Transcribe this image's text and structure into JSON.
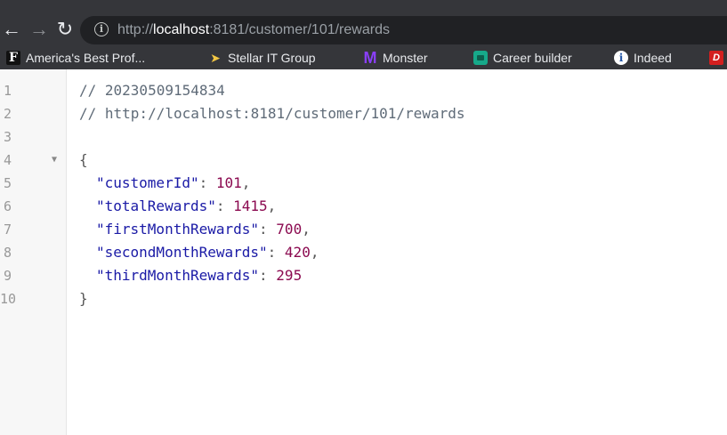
{
  "browser": {
    "url_prefix": "http://",
    "url_host": "localhost",
    "url_rest": ":8181/customer/101/rewards",
    "bookmarks": [
      {
        "label": "America's Best Prof...",
        "icon": "f-logo-icon"
      },
      {
        "label": "Stellar IT Group",
        "icon": "rocket-icon"
      },
      {
        "label": "Monster",
        "icon": "monster-m-icon"
      },
      {
        "label": "Career builder",
        "icon": "careerbuilder-icon"
      },
      {
        "label": "Indeed",
        "icon": "indeed-icon"
      },
      {
        "label": "",
        "icon": "red-d-icon"
      }
    ]
  },
  "json_view": {
    "comment_timestamp": "// 20230509154834",
    "comment_url": "// http://localhost:8181/customer/101/rewards",
    "line_numbers": [
      "1",
      "2",
      "3",
      "4",
      "5",
      "6",
      "7",
      "8",
      "9",
      "10"
    ],
    "open_brace": "{",
    "close_brace": "}",
    "fields": [
      {
        "key": "\"customerId\"",
        "value": "101",
        "trail": ","
      },
      {
        "key": "\"totalRewards\"",
        "value": "1415",
        "trail": ","
      },
      {
        "key": "\"firstMonthRewards\"",
        "value": "700",
        "trail": ","
      },
      {
        "key": "\"secondMonthRewards\"",
        "value": "420",
        "trail": ","
      },
      {
        "key": "\"thirdMonthRewards\"",
        "value": "295",
        "trail": ""
      }
    ]
  }
}
